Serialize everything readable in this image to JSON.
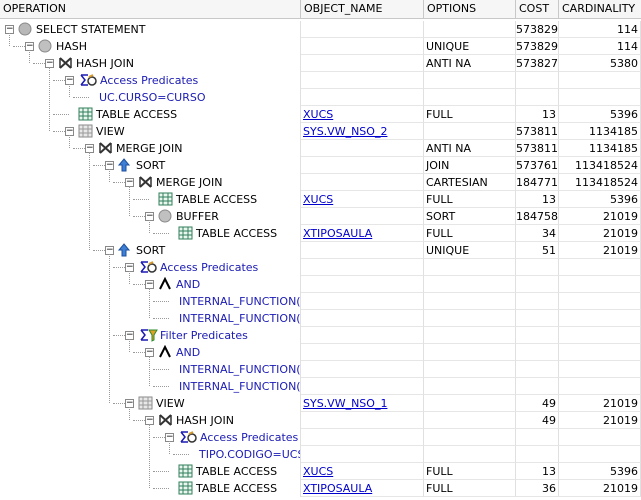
{
  "columns": {
    "operation": "OPERATION",
    "object_name": "OBJECT_NAME",
    "options": "OPTIONS",
    "cost": "COST",
    "cardinality": "CARDINALITY"
  },
  "rows": [
    {
      "label": "SELECT STATEMENT",
      "icon": "select-icon",
      "object": "",
      "options": "",
      "cost": "573829",
      "card": "114"
    },
    {
      "label": "HASH",
      "icon": "hash-icon",
      "object": "",
      "options": "UNIQUE",
      "cost": "573829",
      "card": "114"
    },
    {
      "label": "HASH JOIN",
      "icon": "join-icon",
      "object": "",
      "options": "ANTI NA",
      "cost": "573827",
      "card": "5380"
    },
    {
      "label": "Access Predicates",
      "icon": "access-predicates-icon",
      "object": "",
      "options": "",
      "cost": "",
      "card": ""
    },
    {
      "label": "UC.CURSO=CURSO",
      "icon": "",
      "object": "",
      "options": "",
      "cost": "",
      "card": ""
    },
    {
      "label": "TABLE ACCESS",
      "icon": "table-icon",
      "object": "XUCS",
      "options": "FULL",
      "cost": "13",
      "card": "5396"
    },
    {
      "label": "VIEW",
      "icon": "view-icon",
      "object": "SYS.VW_NSO_2",
      "options": "",
      "cost": "573811",
      "card": "1134185"
    },
    {
      "label": "MERGE JOIN",
      "icon": "join-icon",
      "object": "",
      "options": "ANTI NA",
      "cost": "573811",
      "card": "1134185"
    },
    {
      "label": "SORT",
      "icon": "sort-icon",
      "object": "",
      "options": "JOIN",
      "cost": "573761",
      "card": "113418524"
    },
    {
      "label": "MERGE JOIN",
      "icon": "join-icon",
      "object": "",
      "options": "CARTESIAN",
      "cost": "184771",
      "card": "113418524"
    },
    {
      "label": "TABLE ACCESS",
      "icon": "table-icon",
      "object": "XUCS",
      "options": "FULL",
      "cost": "13",
      "card": "5396"
    },
    {
      "label": "BUFFER",
      "icon": "buffer-icon",
      "object": "",
      "options": "SORT",
      "cost": "184758",
      "card": "21019"
    },
    {
      "label": "TABLE ACCESS",
      "icon": "table-icon",
      "object": "XTIPOSAULA",
      "options": "FULL",
      "cost": "34",
      "card": "21019"
    },
    {
      "label": "SORT",
      "icon": "sort-icon",
      "object": "",
      "options": "UNIQUE",
      "cost": "51",
      "card": "21019"
    },
    {
      "label": "Access Predicates",
      "icon": "access-predicates-icon",
      "object": "",
      "options": "",
      "cost": "",
      "card": ""
    },
    {
      "label": "AND",
      "icon": "and-icon",
      "object": "",
      "options": "",
      "cost": "",
      "card": ""
    },
    {
      "label": "INTERNAL_FUNCTION(CURSO)=INTERNAL_FUNCTION(CURSO)",
      "icon": "",
      "object": "",
      "options": "",
      "cost": "",
      "card": ""
    },
    {
      "label": "INTERNAL_FUNCTION(TIPO)=INTERNAL_FUNCTION(TIPO)",
      "icon": "",
      "object": "",
      "options": "",
      "cost": "",
      "card": ""
    },
    {
      "label": "Filter Predicates",
      "icon": "filter-predicates-icon",
      "object": "",
      "options": "",
      "cost": "",
      "card": ""
    },
    {
      "label": "AND",
      "icon": "and-icon",
      "object": "",
      "options": "",
      "cost": "",
      "card": ""
    },
    {
      "label": "INTERNAL_FUNCTION(TIPO)=INTERNAL_FUNCTION(TIPO)",
      "icon": "",
      "object": "",
      "options": "",
      "cost": "",
      "card": ""
    },
    {
      "label": "INTERNAL_FUNCTION(CURSO)=INTERNAL_FUNCTION(CURSO)",
      "icon": "",
      "object": "",
      "options": "",
      "cost": "",
      "card": ""
    },
    {
      "label": "VIEW",
      "icon": "view-icon",
      "object": "SYS.VW_NSO_1",
      "options": "",
      "cost": "49",
      "card": "21019"
    },
    {
      "label": "HASH JOIN",
      "icon": "join-icon",
      "object": "",
      "options": "",
      "cost": "49",
      "card": "21019"
    },
    {
      "label": "Access Predicates",
      "icon": "access-predicates-icon",
      "object": "",
      "options": "",
      "cost": "",
      "card": ""
    },
    {
      "label": "TIPO.CODIGO=UCS.CODIGO",
      "icon": "",
      "object": "",
      "options": "",
      "cost": "",
      "card": ""
    },
    {
      "label": "TABLE ACCESS",
      "icon": "table-icon",
      "object": "XUCS",
      "options": "FULL",
      "cost": "13",
      "card": "5396"
    },
    {
      "label": "TABLE ACCESS",
      "icon": "table-icon",
      "object": "XTIPOSAULA",
      "options": "FULL",
      "cost": "36",
      "card": "21019"
    }
  ]
}
